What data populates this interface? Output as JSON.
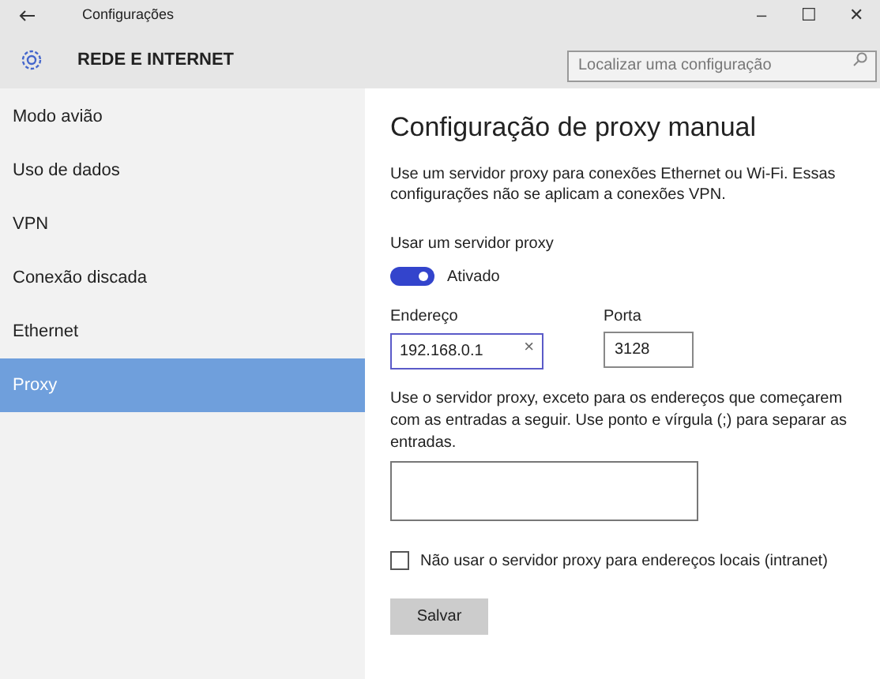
{
  "window": {
    "title": "Configurações",
    "controls": [
      "–",
      "☐",
      "✕"
    ]
  },
  "header": {
    "title": "REDE E INTERNET",
    "search": {
      "placeholder": "Localizar uma configuração"
    }
  },
  "sidebar": {
    "items": [
      {
        "label": "Modo avião",
        "selected": false
      },
      {
        "label": "Uso de dados",
        "selected": false
      },
      {
        "label": "VPN",
        "selected": false
      },
      {
        "label": "Conexão discada",
        "selected": false
      },
      {
        "label": "Ethernet",
        "selected": false
      },
      {
        "label": "Proxy",
        "selected": true
      }
    ]
  },
  "content": {
    "title": "Configuração de proxy manual",
    "description": "Use um servidor proxy para conexões Ethernet ou Wi-Fi. Essas configurações não se aplicam a conexões VPN.",
    "proxy_toggle": {
      "label": "Usar um servidor proxy",
      "on": true,
      "state_text": "Ativado"
    },
    "address": {
      "label": "Endereço",
      "value": "192.168.0.1",
      "clear": "×"
    },
    "port": {
      "label": "Porta",
      "value": "3128"
    },
    "exceptions_text": "Use o servidor proxy, exceto para os endereços que começarem com as entradas a seguir. Use ponto e vírgula (;) para separar as entradas.",
    "local_checkbox": {
      "label": "Não usar o servidor proxy para endereços locais (intranet)",
      "checked": false
    },
    "save_button": "Salvar"
  }
}
